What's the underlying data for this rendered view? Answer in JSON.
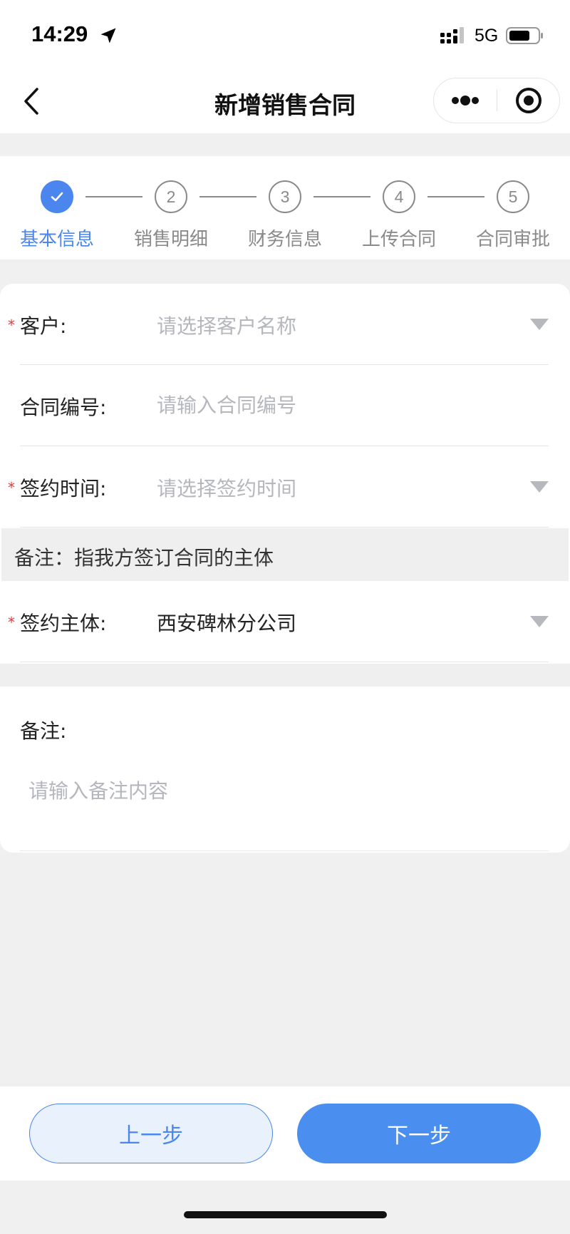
{
  "status_bar": {
    "time": "14:29",
    "network": "5G",
    "icons": [
      "location-arrow-icon",
      "signal-icon",
      "battery-icon"
    ]
  },
  "nav": {
    "title": "新增销售合同",
    "icons": [
      "back-chevron-icon",
      "more-dots-icon",
      "close-target-icon"
    ]
  },
  "steps": [
    {
      "number": "1",
      "label": "基本信息",
      "active": true,
      "icon": "check-icon"
    },
    {
      "number": "2",
      "label": "销售明细",
      "active": false
    },
    {
      "number": "3",
      "label": "财务信息",
      "active": false
    },
    {
      "number": "4",
      "label": "上传合同",
      "active": false
    },
    {
      "number": "5",
      "label": "合同审批",
      "active": false
    }
  ],
  "form": {
    "customer": {
      "label": "客户:",
      "placeholder": "请选择客户名称",
      "required": "*"
    },
    "contract_no": {
      "label": "合同编号:",
      "placeholder": "请输入合同编号"
    },
    "sign_time": {
      "label": "签约时间:",
      "placeholder": "请选择签约时间",
      "required": "*"
    },
    "note_band": "备注：指我方签订合同的主体",
    "sign_entity": {
      "label": "签约主体:",
      "value": "西安碑林分公司",
      "required": "*"
    },
    "remark": {
      "label": "备注:",
      "placeholder": "请输入备注内容"
    }
  },
  "buttons": {
    "prev": "上一步",
    "next": "下一步"
  },
  "colors": {
    "accent": "#4a86ee",
    "required": "#e23b3b",
    "placeholder": "#b5b7bd",
    "background": "#f0f0f0"
  }
}
